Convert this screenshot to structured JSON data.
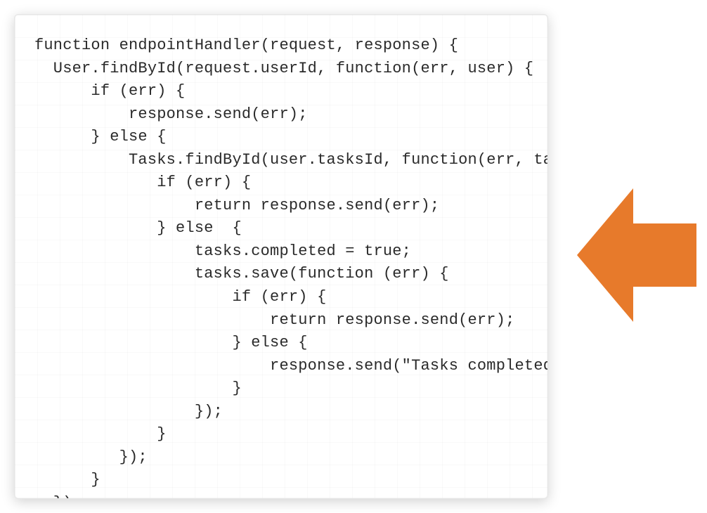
{
  "colors": {
    "arrow": "#e77a2b",
    "panelBorder": "#e6e6e6",
    "codeText": "#2a2a2a"
  },
  "code": {
    "text": "function endpointHandler(request, response) {\n  User.findById(request.userId, function(err, user) {\n      if (err) {\n          response.send(err);\n      } else {\n          Tasks.findById(user.tasksId, function(err, tasks) {\n             if (err) {\n                 return response.send(err);\n             } else  {\n                 tasks.completed = true;\n                 tasks.save(function (err) {\n                     if (err) {\n                         return response.send(err);\n                     } else {\n                         response.send(\"Tasks completed\");\n                     }\n                 });\n             }\n         });\n      }\n  });"
  },
  "arrow": {
    "semantic": "left-arrow-icon",
    "direction": "left"
  }
}
